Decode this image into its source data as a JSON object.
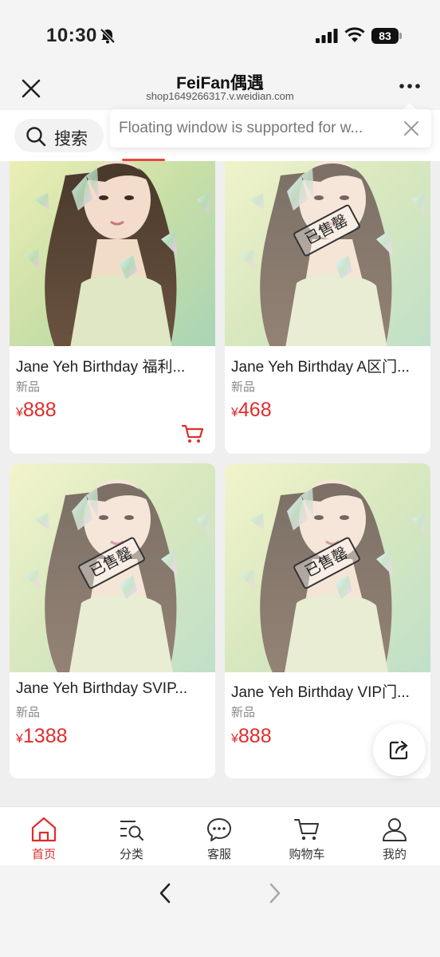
{
  "status_bar": {
    "time": "10:30",
    "battery_level": "83",
    "icons": [
      "bell-muted-icon",
      "signal-icon",
      "wifi-icon",
      "battery-icon"
    ]
  },
  "nav": {
    "title": "FeiFan偶遇",
    "url": "shop1649266317.v.weidian.com",
    "close_icon": "close-icon",
    "more_icon": "more-icon"
  },
  "search": {
    "label": "搜索",
    "icon": "search-icon"
  },
  "floating_tip": {
    "text": "Floating window is supported for w...",
    "close_icon": "close-icon"
  },
  "products": [
    {
      "title": "Jane Yeh Birthday 福利...",
      "tag": "新品",
      "currency": "¥",
      "price": "888",
      "sold_out": false,
      "has_cart": true
    },
    {
      "title": "Jane Yeh Birthday A区门...",
      "tag": "新品",
      "currency": "¥",
      "price": "468",
      "sold_out": true,
      "stamp": "已售罄"
    },
    {
      "title": "Jane Yeh Birthday SVIP...",
      "tag": "新品",
      "currency": "¥",
      "price": "1388",
      "sold_out": true,
      "stamp": "已售罄"
    },
    {
      "title": "Jane Yeh Birthday VIP门...",
      "tag": "新品",
      "currency": "¥",
      "price": "888",
      "sold_out": true,
      "stamp": "已售罄"
    }
  ],
  "tab_bar": {
    "items": [
      {
        "label": "首页",
        "icon": "home-icon",
        "active": true
      },
      {
        "label": "分类",
        "icon": "category-icon",
        "active": false
      },
      {
        "label": "客服",
        "icon": "chat-icon",
        "active": false
      },
      {
        "label": "购物车",
        "icon": "cart-icon",
        "active": false
      },
      {
        "label": "我的",
        "icon": "user-icon",
        "active": false
      }
    ]
  },
  "colors": {
    "accent": "#e02c2c",
    "tab_indicator": "#e64545",
    "background": "#efefef"
  }
}
